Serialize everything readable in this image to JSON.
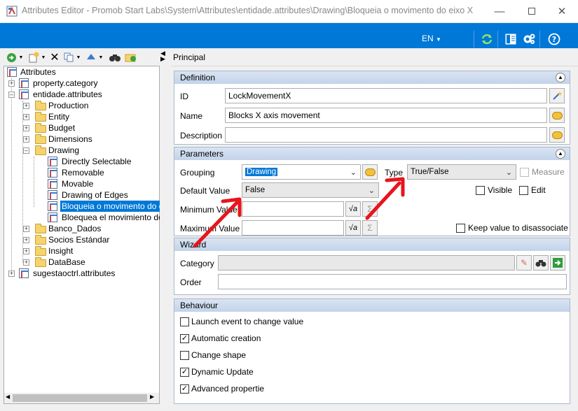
{
  "window": {
    "title": "Attributes Editor - Promob Start Labs\\System\\Attributes\\entidade.attributes\\Drawing\\Bloqueia o movimento do eixo X",
    "lang": "EN"
  },
  "tree": {
    "root": "Attributes",
    "items": [
      {
        "label": "property.category"
      },
      {
        "label": "entidade.attributes"
      },
      {
        "label": "Production"
      },
      {
        "label": "Entity"
      },
      {
        "label": "Budget"
      },
      {
        "label": "Dimensions"
      },
      {
        "label": "Drawing"
      },
      {
        "label": "Directly Selectable"
      },
      {
        "label": "Removable"
      },
      {
        "label": "Movable"
      },
      {
        "label": "Drawing of Edges"
      },
      {
        "label": "Bloqueia o movimento do ei"
      },
      {
        "label": "Bloequea el movimiento del"
      },
      {
        "label": "Banco_Dados"
      },
      {
        "label": "Socios Estándar"
      },
      {
        "label": "Insight"
      },
      {
        "label": "DataBase"
      },
      {
        "label": "sugestaoctrl.attributes"
      }
    ]
  },
  "principal": "Principal",
  "definition": {
    "header": "Definition",
    "id_label": "ID",
    "id_value": "LockMovementX",
    "name_label": "Name",
    "name_value": "Blocks X axis movement",
    "description_label": "Description",
    "description_value": ""
  },
  "parameters": {
    "header": "Parameters",
    "grouping_label": "Grouping",
    "grouping_value": "Drawing",
    "type_label": "Type",
    "type_value": "True/False",
    "measure_label": "Measure",
    "default_label": "Default Value",
    "default_value": "False",
    "visible_label": "Visible",
    "edit_label": "Edit",
    "min_label": "Minimum Value",
    "max_label": "Maximum Value",
    "keep_label": "Keep value to disassociate"
  },
  "wizard": {
    "header": "Wizard",
    "category_label": "Category",
    "order_label": "Order"
  },
  "behaviour": {
    "header": "Behaviour",
    "items": [
      {
        "label": "Launch event to change value",
        "checked": false
      },
      {
        "label": "Automatic creation",
        "checked": true
      },
      {
        "label": "Change shape",
        "checked": false
      },
      {
        "label": "Dynamic Update",
        "checked": true
      },
      {
        "label": "Advanced propertie",
        "checked": true
      }
    ]
  },
  "colors": {
    "accent": "#0078d7",
    "annotation": "#e8141c"
  }
}
